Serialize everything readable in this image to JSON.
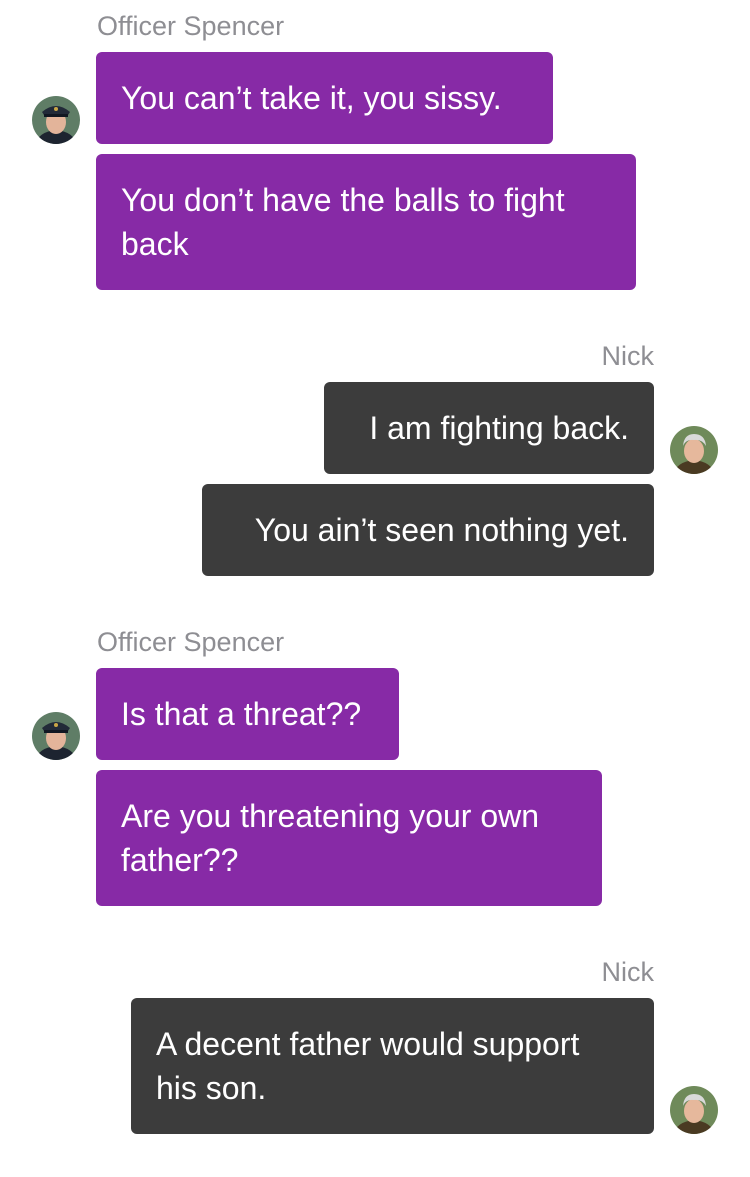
{
  "chat": {
    "groups": [
      {
        "sender": "Officer Spencer",
        "side": "left",
        "avatar": "police-officer-avatar-icon",
        "messages": [
          "You can’t take it, you sissy.",
          "You don’t have the balls to fight back"
        ]
      },
      {
        "sender": "Nick",
        "side": "right",
        "avatar": "gray-haired-man-avatar-icon",
        "messages": [
          "I am fighting back.",
          "You ain’t seen nothing yet."
        ]
      },
      {
        "sender": "Officer Spencer",
        "side": "left",
        "avatar": "police-officer-avatar-icon",
        "messages": [
          "Is that a threat??",
          "Are you threatening your own father??"
        ]
      },
      {
        "sender": "Nick",
        "side": "right",
        "avatar": "gray-haired-man-avatar-icon",
        "messages": [
          "A decent father would support his son."
        ]
      }
    ]
  },
  "colors": {
    "left_bubble": "#872aa6",
    "right_bubble": "#3c3c3c",
    "sender_name": "#8e8e93",
    "background": "#ffffff"
  }
}
